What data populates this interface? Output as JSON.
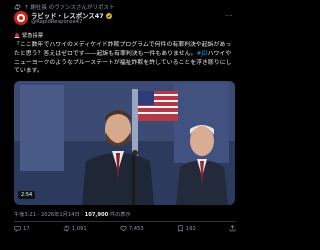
{
  "repost": {
    "text": "↑ 謝社長 のヴァンスさんがリポスト"
  },
  "account": {
    "name": "ラビッド・レスポンス47",
    "handle": "@RapidResponse47",
    "more": "···"
  },
  "tweet": {
    "tag": "緊急投票",
    "text_before": "「ここ数年でハワイのメディケイド詐欺プログラムで何件の有罪判決や起訴があったと思う？答えはゼロです——起訴も有罪判決も一件もありません。",
    "hashtag": "#JD",
    "text_after": "ハワイやニューヨークのようなブルーステートが福祉詐欺を許していることを浮き彫りにしています。"
  },
  "media": {
    "timecode": "2:54"
  },
  "meta": {
    "time": "午後3:21 · 2026年1月14日 · ",
    "views": "107,900",
    "views_label": " 件の表示"
  },
  "actions": {
    "replies": "17",
    "reposts": "1,091",
    "likes": "7,453",
    "bookmarks": "192"
  },
  "colors": {
    "background": "#000000",
    "text": "#e7e9ea",
    "muted": "#8b98a5",
    "accent": "#1d9bf0",
    "brand": "#c8281e"
  }
}
